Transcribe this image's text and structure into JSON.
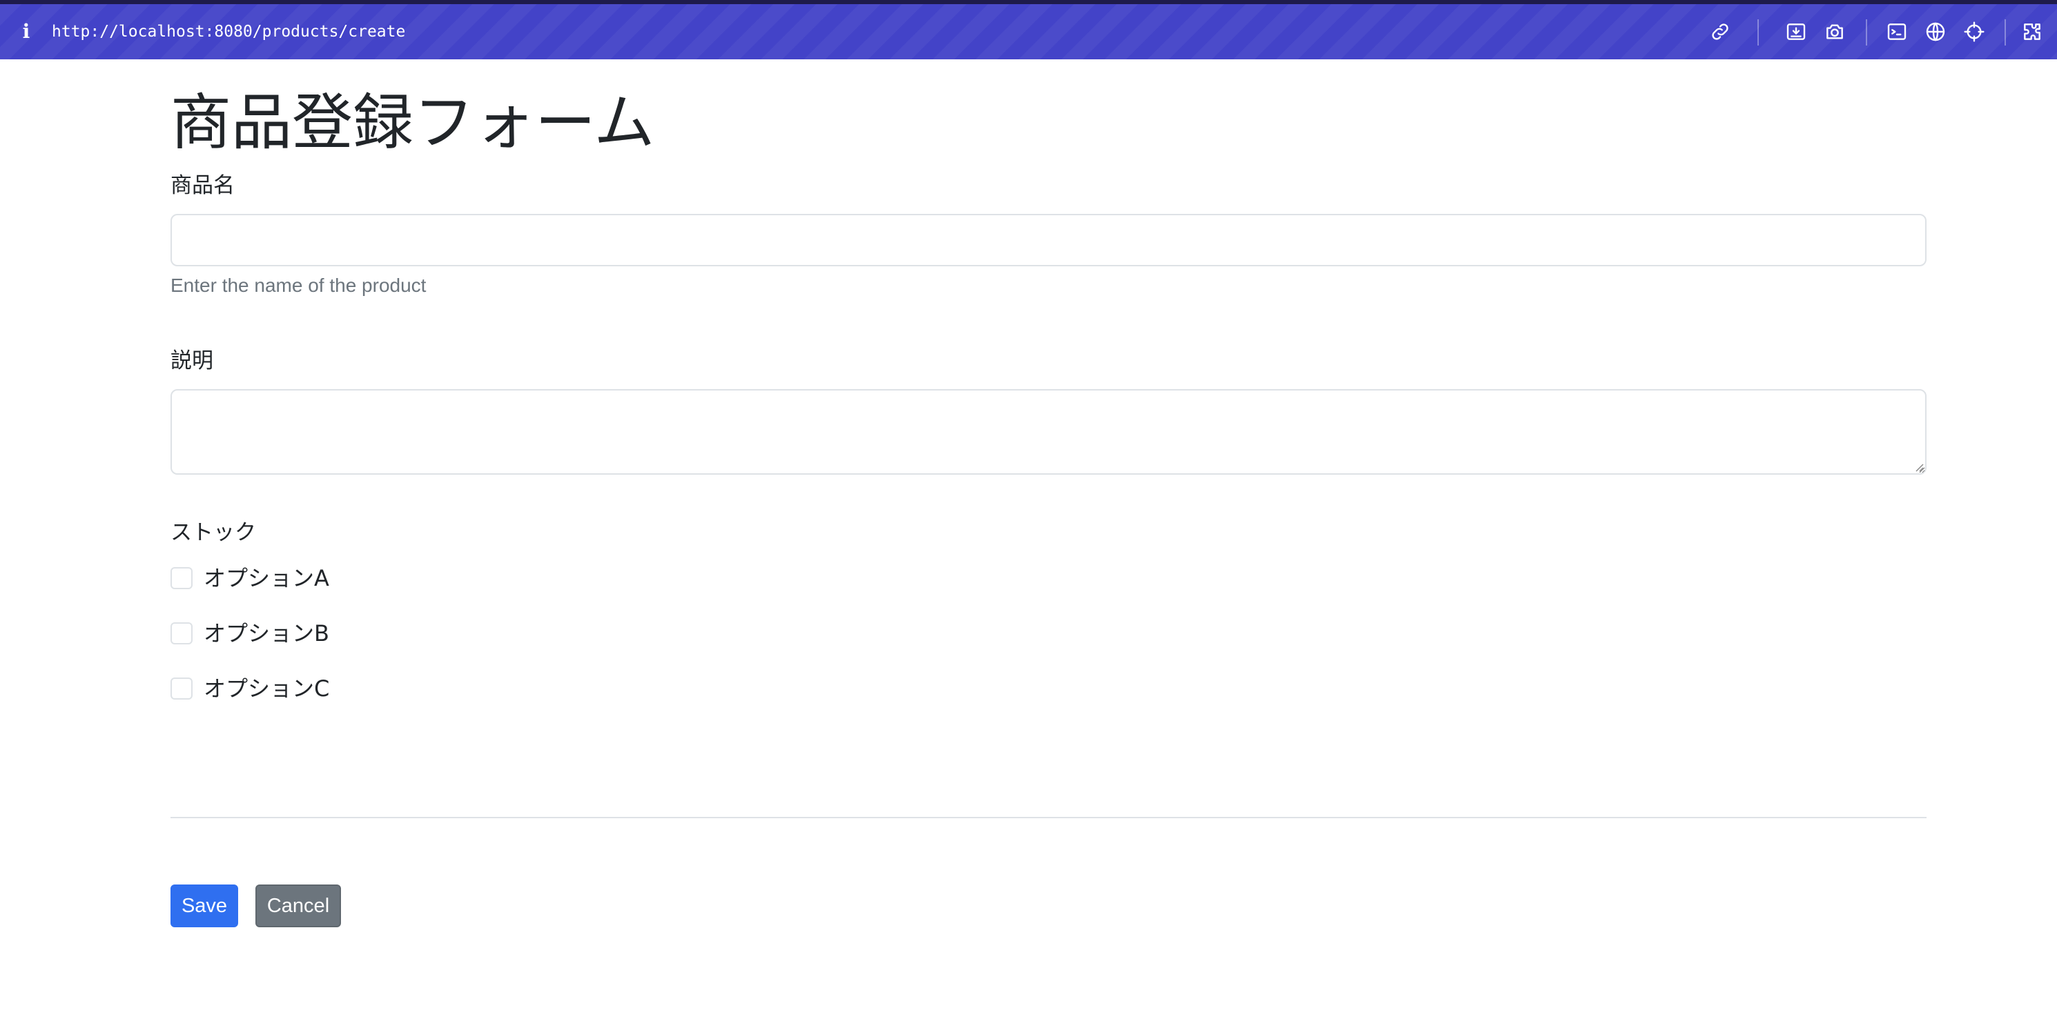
{
  "browser": {
    "url": "http://localhost:8080/products/create",
    "info_icon": "i",
    "icons": [
      "link-icon",
      "screenshot-area-icon",
      "camera-icon",
      "terminal-icon",
      "globe-icon",
      "crosshair-icon",
      "extension-icon"
    ],
    "bar_color": "#4343c8"
  },
  "form": {
    "title": "商品登録フォーム",
    "name_label": "商品名",
    "name_value": "",
    "name_help": "Enter the name of the product",
    "description_label": "説明",
    "description_value": "",
    "stock_label": "ストック",
    "options": [
      {
        "label": "オプションA",
        "checked": false
      },
      {
        "label": "オプションB",
        "checked": false
      },
      {
        "label": "オプションC",
        "checked": false
      }
    ]
  },
  "actions": {
    "save_label": "Save",
    "cancel_label": "Cancel",
    "save_color": "#2f6ff0",
    "cancel_color": "#6c757d"
  }
}
